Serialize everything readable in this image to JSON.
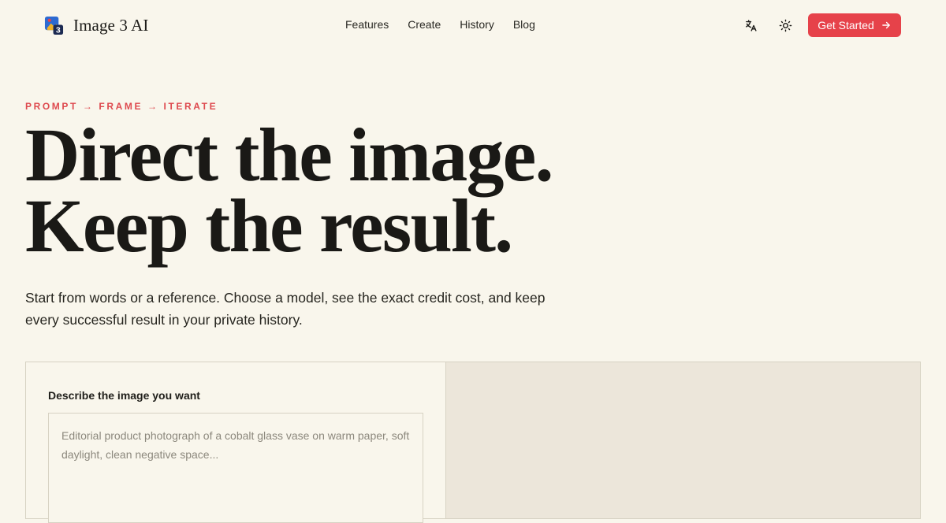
{
  "header": {
    "brand": "Image 3 AI",
    "nav": [
      {
        "label": "Features"
      },
      {
        "label": "Create"
      },
      {
        "label": "History"
      },
      {
        "label": "Blog"
      }
    ],
    "cta_label": "Get Started",
    "icons": {
      "logo": "image-3-logo-icon",
      "translate": "translate-icon",
      "theme": "sun-icon",
      "cta_arrow": "arrow-right-icon"
    }
  },
  "hero": {
    "eyebrow": "PROMPT → FRAME → ITERATE",
    "headline_line1": "Direct the image.",
    "headline_line2": "Keep the result.",
    "subtext": "Start from words or a reference. Choose a model, see the exact credit cost, and keep every successful result in your private history."
  },
  "composer": {
    "label": "Describe the image you want",
    "prompt_value": "",
    "prompt_placeholder": "Editorial product photograph of a cobalt glass vase on warm paper, soft daylight, clean negative space..."
  },
  "colors": {
    "background": "#f9f6ec",
    "accent": "#e6424a",
    "eyebrow": "#de4a4f",
    "preview_panel": "#ece6da",
    "border": "#d7d2c3"
  }
}
